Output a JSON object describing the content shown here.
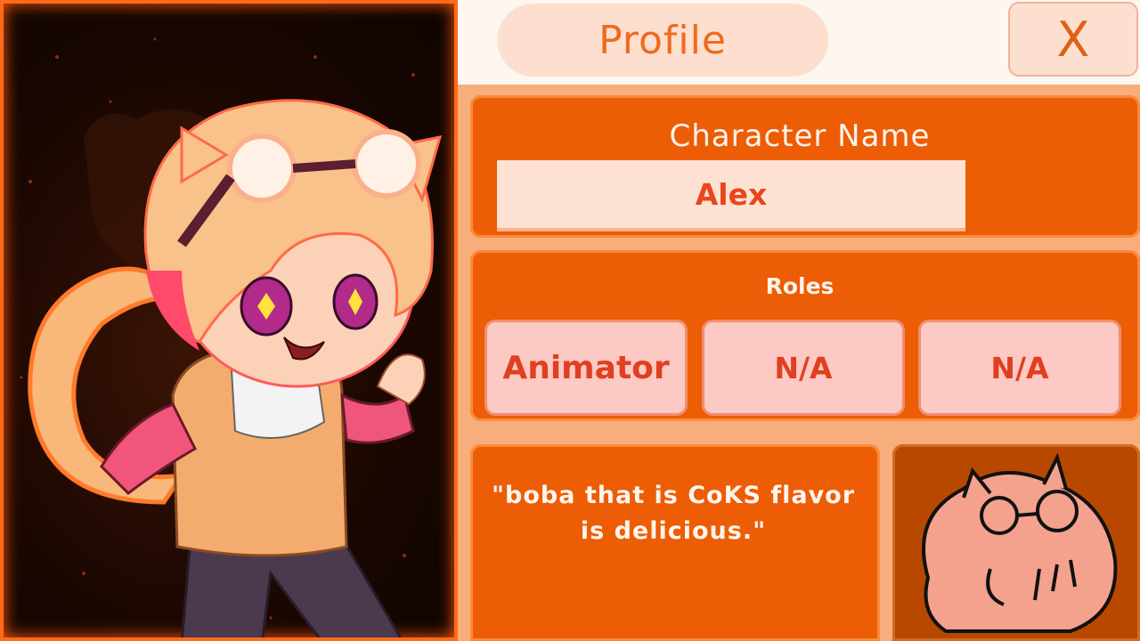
{
  "header": {
    "title": "Profile",
    "close_label": "X"
  },
  "character": {
    "name_label": "Character Name",
    "name_value": "Alex"
  },
  "roles": {
    "label": "Roles",
    "items": [
      "Animator",
      "N/A",
      "N/A"
    ]
  },
  "quote": {
    "text": "\"boba that is CoKS flavor is delicious.\""
  },
  "colors": {
    "accent": "#ec5d05",
    "header_bg": "#fef6f0",
    "pill_bg": "#fddfd0",
    "role_bg": "#fcc9c5",
    "text_red": "#e0401f"
  }
}
